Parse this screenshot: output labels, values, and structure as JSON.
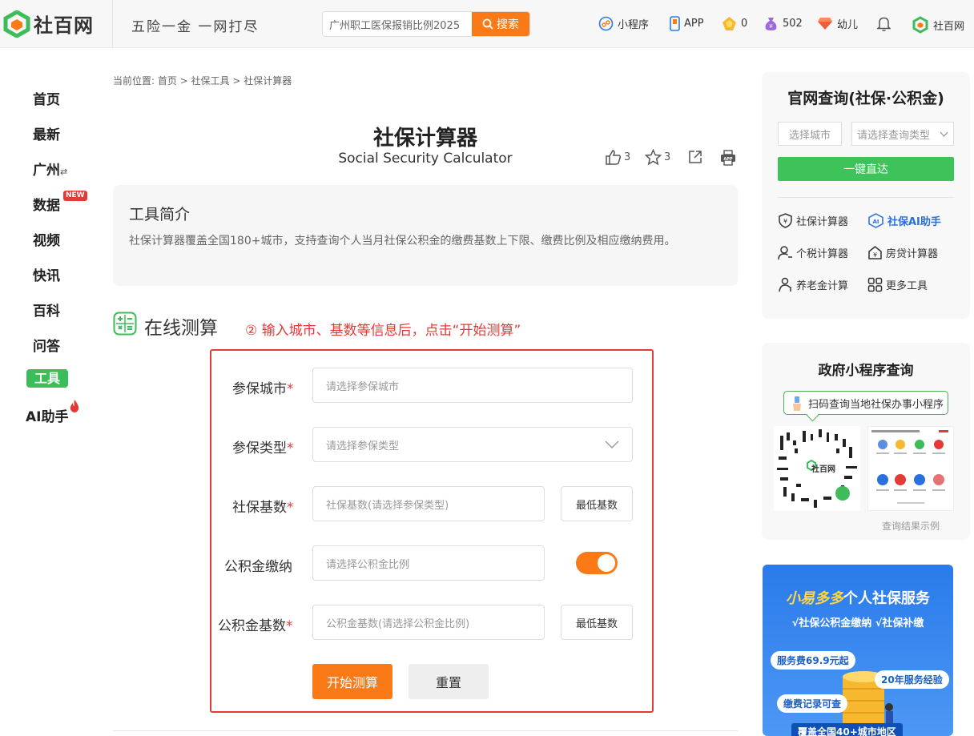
{
  "header": {
    "logo_text": "社百网",
    "slogan": "五险一金 一网打尽",
    "search": {
      "placeholder": "广州职工医保报销比例2025",
      "button_label": "搜索"
    },
    "nav": {
      "miniprogram": "小程序",
      "app": "APP",
      "coins": "0",
      "points": "502",
      "role": "幼儿",
      "user": "社百网"
    }
  },
  "sidebar": {
    "items": [
      "首页",
      "最新",
      "广州",
      "数据",
      "视频",
      "快讯",
      "百科",
      "问答",
      "工具",
      "AI助手"
    ],
    "new_badge": "NEW",
    "switch_symbol": "⇄"
  },
  "breadcrumb": "当前位置: 首页 > 社保工具 > 社保计算器",
  "page": {
    "title": "社保计算器",
    "subtitle": "Social Security Calculator",
    "likes": "3",
    "stars": "3"
  },
  "intro": {
    "title": "工具简介",
    "text": "社保计算器覆盖全国180+城市，支持查询个人当月社保公积金的缴费基数上下限、缴费比例及相应缴纳费用。"
  },
  "calc": {
    "section_title": "在线测算",
    "hint": "② 输入城市、基数等信息后，点击“开始测算”",
    "fields": {
      "city": {
        "label": "参保城市",
        "placeholder": "请选择参保城市"
      },
      "type": {
        "label": "参保类型",
        "placeholder": "请选择参保类型"
      },
      "base": {
        "label": "社保基数",
        "placeholder": "社保基数(请选择参保类型)",
        "button": "最低基数"
      },
      "fund": {
        "label": "公积金缴纳",
        "placeholder": "请选择公积金比例",
        "enabled": true
      },
      "fund_base": {
        "label": "公积金基数",
        "placeholder": "公积金基数(请选择公积金比例)",
        "button": "最低基数"
      }
    },
    "required_mark": "*",
    "start_label": "开始测算",
    "reset_label": "重置"
  },
  "official_query": {
    "title": "官网查询(社保·公积金)",
    "city_placeholder": "选择城市",
    "type_placeholder": "请选择查询类型",
    "go_label": "一键直达",
    "tools": [
      "社保计算器",
      "社保AI助手",
      "个税计算器",
      "房贷计算器",
      "养老金计算",
      "更多工具"
    ]
  },
  "gov_query": {
    "title": "政府小程序查询",
    "tip": "扫码查询当地社保办事小程序",
    "qr_label": "社百网",
    "caption": "查询结果示例"
  },
  "banner": {
    "title_brand": "小易多多",
    "title_rest": "个人社保服务",
    "subtitle": "√社保公积金缴纳  √社保补缴",
    "tag1": "服务费69.9元起",
    "tag2": "20年服务经验",
    "tag3": "缴费记录可查",
    "footer": "覆盖全国40+城市地区"
  },
  "colors": {
    "accent": "#fa7a18",
    "green": "#3dbd5a",
    "red": "#e53935",
    "blue_banner": "#2a7bea"
  }
}
